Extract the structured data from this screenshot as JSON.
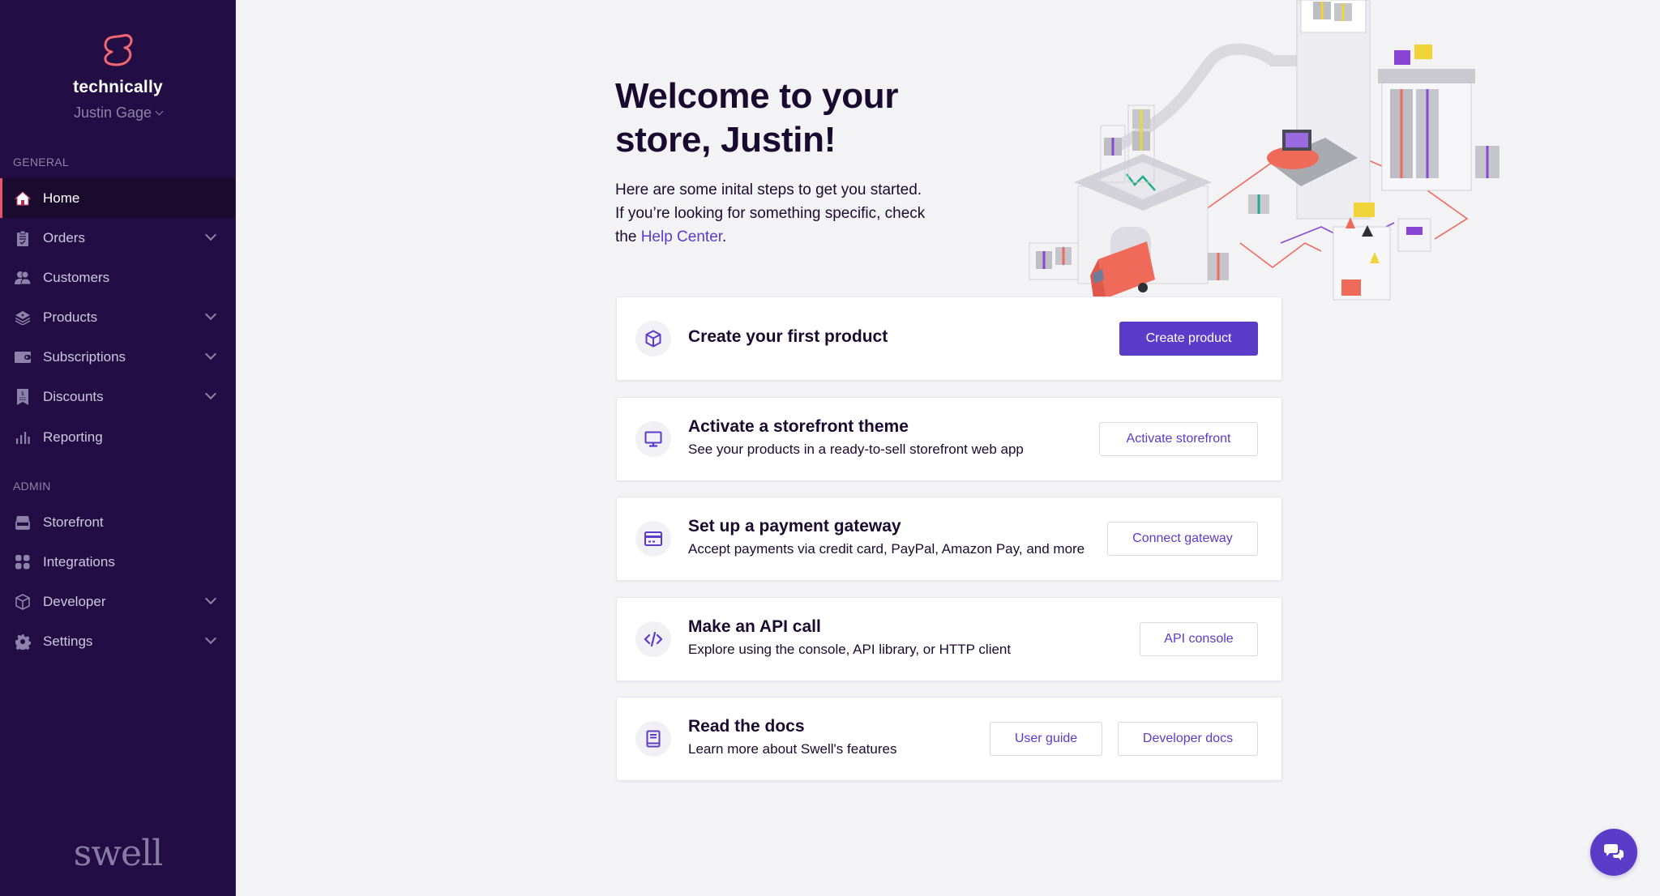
{
  "sidebar": {
    "store_name": "technically",
    "user_name": "Justin Gage",
    "logo_icon": "swell-s-logo-icon",
    "sections": {
      "general_label": "GENERAL",
      "admin_label": "ADMIN"
    },
    "general_items": [
      {
        "label": "Home",
        "icon": "home-icon",
        "active": true,
        "expandable": false
      },
      {
        "label": "Orders",
        "icon": "clipboard-icon",
        "active": false,
        "expandable": true
      },
      {
        "label": "Customers",
        "icon": "users-icon",
        "active": false,
        "expandable": false
      },
      {
        "label": "Products",
        "icon": "layers-icon",
        "active": false,
        "expandable": true
      },
      {
        "label": "Subscriptions",
        "icon": "wallet-icon",
        "active": false,
        "expandable": true
      },
      {
        "label": "Discounts",
        "icon": "receipt-icon",
        "active": false,
        "expandable": true
      },
      {
        "label": "Reporting",
        "icon": "bar-chart-icon",
        "active": false,
        "expandable": false
      }
    ],
    "admin_items": [
      {
        "label": "Storefront",
        "icon": "store-icon",
        "active": false,
        "expandable": false
      },
      {
        "label": "Integrations",
        "icon": "grid-icon",
        "active": false,
        "expandable": false
      },
      {
        "label": "Developer",
        "icon": "cube-icon",
        "active": false,
        "expandable": true
      },
      {
        "label": "Settings",
        "icon": "gear-icon",
        "active": false,
        "expandable": true
      }
    ],
    "footer_brand": "swell"
  },
  "main": {
    "title_line1": "Welcome to your",
    "title_line2": "store, Justin!",
    "intro_line1": "Here are some inital steps to get you started.",
    "intro_line2": "If you’re looking for something specific, check",
    "intro_line3_prefix": "the ",
    "help_link": "Help Center",
    "intro_line3_suffix": ".",
    "cards": [
      {
        "title": "Create your first product",
        "description": "",
        "icon": "box-icon",
        "buttons": [
          {
            "label": "Create product",
            "style": "primary"
          }
        ]
      },
      {
        "title": "Activate a storefront theme",
        "description": "See your products in a ready-to-sell storefront web app",
        "icon": "monitor-icon",
        "buttons": [
          {
            "label": "Activate storefront",
            "style": "outline"
          }
        ]
      },
      {
        "title": "Set up a payment gateway",
        "description": "Accept payments via credit card, PayPal, Amazon Pay, and more",
        "icon": "credit-card-icon",
        "buttons": [
          {
            "label": "Connect gateway",
            "style": "outline"
          }
        ]
      },
      {
        "title": "Make an API call",
        "description": "Explore using the console, API library, or HTTP client",
        "icon": "code-icon",
        "buttons": [
          {
            "label": "API console",
            "style": "outline"
          }
        ]
      },
      {
        "title": "Read the docs",
        "description": "Learn more about Swell's features",
        "icon": "book-icon",
        "buttons": [
          {
            "label": "User guide",
            "style": "outline"
          },
          {
            "label": "Developer docs",
            "style": "outline"
          }
        ]
      }
    ]
  },
  "chat": {
    "icon": "chat-bubbles-icon"
  },
  "colors": {
    "sidebar_bg": "#220e44",
    "sidebar_active_bg": "#190a2e",
    "active_indicator": "#e8526a",
    "accent": "#5a3cc9",
    "page_bg": "#f3f3f6",
    "text_dark": "#1a0a30"
  }
}
